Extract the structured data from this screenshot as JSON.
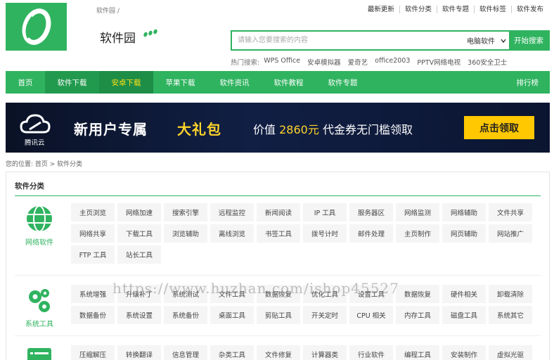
{
  "header": {
    "breadcrumb": "软件园 /",
    "site_name": "软件园",
    "top_links": [
      "最新更新",
      "软件分类",
      "软件专题",
      "软件标签",
      "软件发布"
    ]
  },
  "search": {
    "placeholder": "请输入您要搜索的内容",
    "select_value": "电脑软件",
    "button": "开始搜索"
  },
  "hot": {
    "label": "热门搜索:",
    "items": [
      "WPS Office",
      "安卓模拟器",
      "爱奇艺",
      "office2003",
      "PPTV网络电视",
      "360安全卫士"
    ]
  },
  "nav": {
    "items": [
      "首页",
      "软件下载",
      "安卓下载",
      "苹果下载",
      "软件资讯",
      "软件教程",
      "软件专题"
    ],
    "right": "排行榜"
  },
  "banner": {
    "brand": "腾讯云",
    "headline1": "新用户专属",
    "headline2": "大礼包",
    "value_prefix": "价值",
    "value_amount": "2860元",
    "value_suffix": "代金券无门槛领取",
    "cta": "点击领取"
  },
  "crumb": "您的位置: 首页 > 软件分类",
  "panel": {
    "title": "软件分类",
    "groups": [
      {
        "name": "网络软件",
        "tags": [
          "主页浏览",
          "网络加速",
          "搜索引擎",
          "远程监控",
          "新闻阅读",
          "IP 工具",
          "服务器区",
          "网络监测",
          "网络辅助",
          "文件共享",
          "网络共享",
          "下载工具",
          "浏览辅助",
          "离线浏览",
          "书签工具",
          "拨号计时",
          "邮件处理",
          "主页制作",
          "网页辅助",
          "网站推广",
          "FTP 工具",
          "站长工具"
        ]
      },
      {
        "name": "系统工具",
        "tags": [
          "系统增强",
          "升级补丁",
          "系统测试",
          "文件工具",
          "数据恢复",
          "优化工具",
          "设置工具",
          "数据恢复",
          "硬件相关",
          "卸载清除",
          "数据备份",
          "系统设置",
          "系统备份",
          "桌面工具",
          "剪贴工具",
          "开关定时",
          "CPU 相关",
          "内存工具",
          "磁盘工具",
          "系统其它"
        ]
      },
      {
        "name": "",
        "tags": [
          "压缩解压",
          "转换翻译",
          "信息管理",
          "杂类工具",
          "文件修复",
          "计算器类",
          "行业软件",
          "编程工具",
          "安装制作",
          "虚拟光驱"
        ]
      }
    ]
  },
  "watermark": "https://www.huzhan.com/ishop45527",
  "colors": {
    "brand_green": "#2fb35f",
    "nav_active_text": "#ffe11a",
    "banner_cta": "#ffc800"
  }
}
